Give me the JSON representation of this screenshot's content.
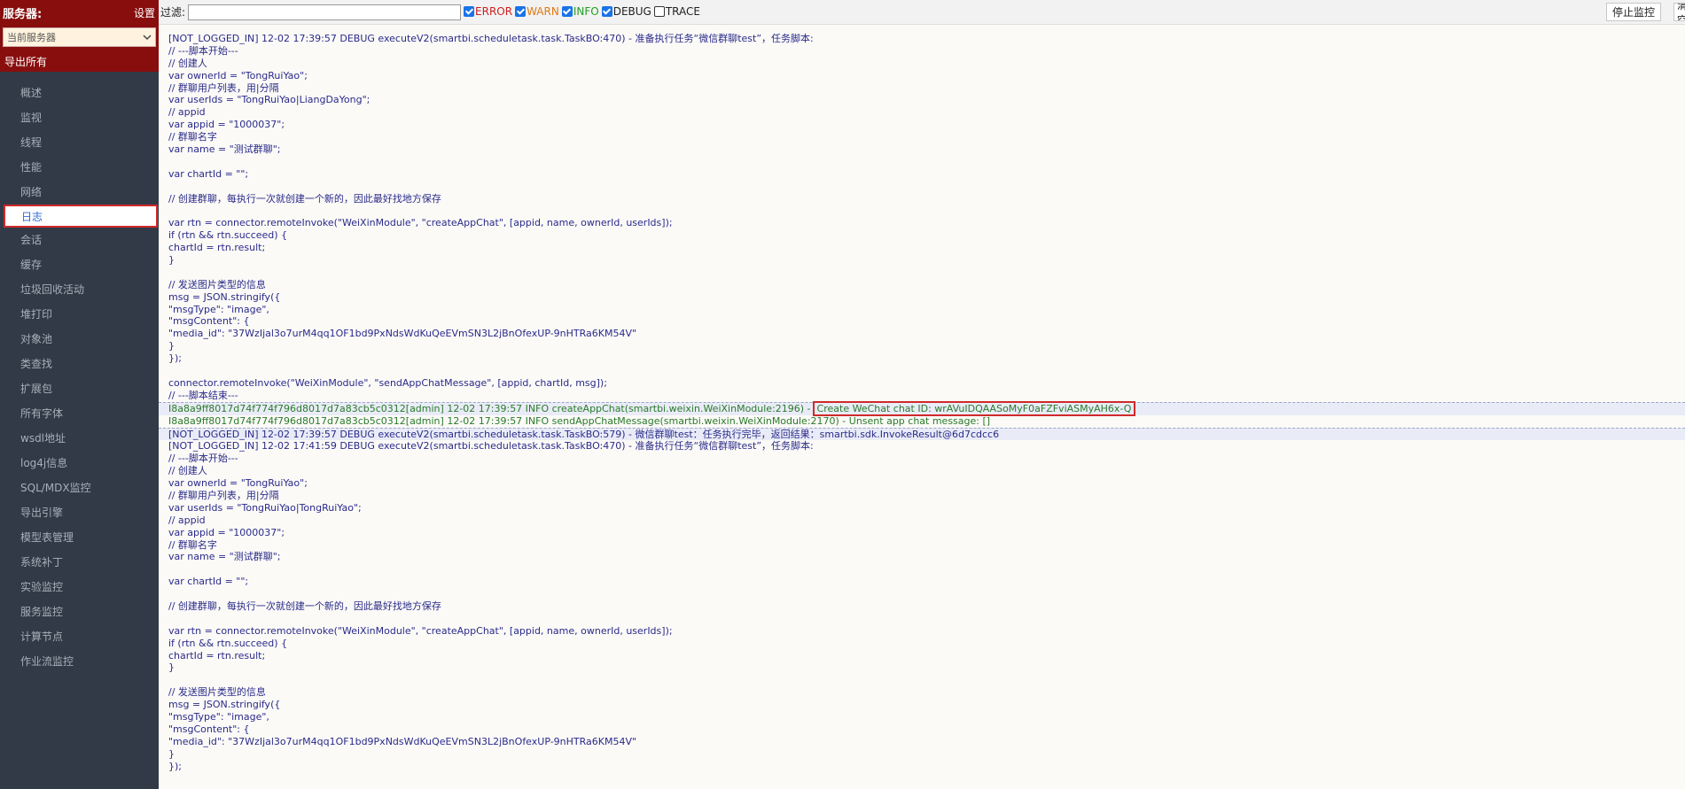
{
  "sidebar": {
    "server_title": "服务器:",
    "settings_label": "设置",
    "server_select_value": "当前服务器",
    "export_all_label": "导出所有",
    "nav_items": [
      {
        "label": "概述"
      },
      {
        "label": "监视"
      },
      {
        "label": "线程"
      },
      {
        "label": "性能"
      },
      {
        "label": "网络"
      },
      {
        "label": "日志",
        "active": true
      },
      {
        "label": "会话"
      },
      {
        "label": "缓存"
      },
      {
        "label": "垃圾回收活动"
      },
      {
        "label": "堆打印"
      },
      {
        "label": "对象池"
      },
      {
        "label": "类查找"
      },
      {
        "label": "扩展包"
      },
      {
        "label": "所有字体"
      },
      {
        "label": "wsdl地址"
      },
      {
        "label": "log4j信息"
      },
      {
        "label": "SQL/MDX监控"
      },
      {
        "label": "导出引擎"
      },
      {
        "label": "模型表管理"
      },
      {
        "label": "系统补丁"
      },
      {
        "label": "实验监控"
      },
      {
        "label": "服务监控"
      },
      {
        "label": "计算节点"
      },
      {
        "label": "作业流监控"
      }
    ]
  },
  "toolbar": {
    "filter_label": "过滤:",
    "filter_value": "",
    "levels": [
      {
        "label": "ERROR",
        "checked": true,
        "color": "#d02020"
      },
      {
        "label": "WARN",
        "checked": true,
        "color": "#e07a10"
      },
      {
        "label": "INFO",
        "checked": true,
        "color": "#20a020"
      },
      {
        "label": "DEBUG",
        "checked": true,
        "color": "#222222"
      },
      {
        "label": "TRACE",
        "checked": false,
        "color": "#222222"
      }
    ],
    "stop_label": "停止监控",
    "clear_label": "清空"
  },
  "log": {
    "lines": [
      {
        "text": "[NOT_LOGGED_IN] 12-02 17:39:57 DEBUG executeV2(smartbi.scheduletask.task.TaskBO:470) - 准备执行任务“微信群聊test”，任务脚本:",
        "level": "debug"
      },
      {
        "text": "// ---脚本开始---",
        "level": "debug"
      },
      {
        "text": "// 创建人",
        "level": "debug"
      },
      {
        "text": "var ownerId = \"TongRuiYao\";",
        "level": "debug"
      },
      {
        "text": "// 群聊用户列表，用|分隔",
        "level": "debug"
      },
      {
        "text": "var userIds = \"TongRuiYao|LiangDaYong\";",
        "level": "debug"
      },
      {
        "text": "// appid",
        "level": "debug"
      },
      {
        "text": "var appid = \"1000037\";",
        "level": "debug"
      },
      {
        "text": "// 群聊名字",
        "level": "debug"
      },
      {
        "text": "var name = \"测试群聊\";",
        "level": "debug"
      },
      {
        "text": "",
        "level": "debug"
      },
      {
        "text": "var chartId = \"\";",
        "level": "debug"
      },
      {
        "text": "",
        "level": "debug"
      },
      {
        "text": "// 创建群聊，每执行一次就创建一个新的，因此最好找地方保存",
        "level": "debug"
      },
      {
        "text": "",
        "level": "debug"
      },
      {
        "text": "var rtn = connector.remoteInvoke(\"WeiXinModule\", \"createAppChat\", [appid, name, ownerId, userIds]);",
        "level": "debug"
      },
      {
        "text": "if (rtn && rtn.succeed) {",
        "level": "debug"
      },
      {
        "text": "chartId = rtn.result;",
        "level": "debug"
      },
      {
        "text": "}",
        "level": "debug"
      },
      {
        "text": "",
        "level": "debug"
      },
      {
        "text": "// 发送图片类型的信息",
        "level": "debug"
      },
      {
        "text": "msg = JSON.stringify({",
        "level": "debug"
      },
      {
        "text": "\"msgType\": \"image\",",
        "level": "debug"
      },
      {
        "text": "\"msgContent\": {",
        "level": "debug"
      },
      {
        "text": "\"media_id\": \"37WzIjal3o7urM4qq1OF1bd9PxNdsWdKuQeEVmSN3L2jBnOfexUP-9nHTRa6KM54V\"",
        "level": "debug"
      },
      {
        "text": "}",
        "level": "debug"
      },
      {
        "text": "});",
        "level": "debug"
      },
      {
        "text": "",
        "level": "debug"
      },
      {
        "text": "connector.remoteInvoke(\"WeiXinModule\", \"sendAppChatMessage\", [appid, chartId, msg]);",
        "level": "debug"
      },
      {
        "text": "// ---脚本结束---",
        "level": "debug"
      },
      {
        "text": "I8a8a9ff8017d74f774f796d8017d7a83cb5c0312[admin] 12-02 17:39:57 INFO createAppChat(smartbi.weixin.WeiXinModule:2196) -",
        "level": "info",
        "highlight": "Create WeChat chat ID: wrAVuIDQAASoMyF0aFZFviASMyAH6x-Q",
        "band": true
      },
      {
        "text": "I8a8a9ff8017d74f774f796d8017d7a83cb5c0312[admin] 12-02 17:39:57 INFO sendAppChatMessage(smartbi.weixin.WeiXinModule:2170) - Unsent app chat message: []",
        "level": "info"
      },
      {
        "text": "[NOT_LOGGED_IN] 12-02 17:39:57 DEBUG executeV2(smartbi.scheduletask.task.TaskBO:579) - 微信群聊test：任务执行完毕，返回结果：smartbi.sdk.InvokeResult@6d7cdcc6",
        "level": "debug",
        "band": true
      },
      {
        "text": "[NOT_LOGGED_IN] 12-02 17:41:59 DEBUG executeV2(smartbi.scheduletask.task.TaskBO:470) - 准备执行任务“微信群聊test”，任务脚本:",
        "level": "debug"
      },
      {
        "text": "// ---脚本开始---",
        "level": "debug"
      },
      {
        "text": "// 创建人",
        "level": "debug"
      },
      {
        "text": "var ownerId = \"TongRuiYao\";",
        "level": "debug"
      },
      {
        "text": "// 群聊用户列表，用|分隔",
        "level": "debug"
      },
      {
        "text": "var userIds = \"TongRuiYao|TongRuiYao\";",
        "level": "debug"
      },
      {
        "text": "// appid",
        "level": "debug"
      },
      {
        "text": "var appid = \"1000037\";",
        "level": "debug"
      },
      {
        "text": "// 群聊名字",
        "level": "debug"
      },
      {
        "text": "var name = \"测试群聊\";",
        "level": "debug"
      },
      {
        "text": "",
        "level": "debug"
      },
      {
        "text": "var chartId = \"\";",
        "level": "debug"
      },
      {
        "text": "",
        "level": "debug"
      },
      {
        "text": "// 创建群聊，每执行一次就创建一个新的，因此最好找地方保存",
        "level": "debug"
      },
      {
        "text": "",
        "level": "debug"
      },
      {
        "text": "var rtn = connector.remoteInvoke(\"WeiXinModule\", \"createAppChat\", [appid, name, ownerId, userIds]);",
        "level": "debug"
      },
      {
        "text": "if (rtn && rtn.succeed) {",
        "level": "debug"
      },
      {
        "text": "chartId = rtn.result;",
        "level": "debug"
      },
      {
        "text": "}",
        "level": "debug"
      },
      {
        "text": "",
        "level": "debug"
      },
      {
        "text": "// 发送图片类型的信息",
        "level": "debug"
      },
      {
        "text": "msg = JSON.stringify({",
        "level": "debug"
      },
      {
        "text": "\"msgType\": \"image\",",
        "level": "debug"
      },
      {
        "text": "\"msgContent\": {",
        "level": "debug"
      },
      {
        "text": "\"media_id\": \"37WzIjal3o7urM4qq1OF1bd9PxNdsWdKuQeEVmSN3L2jBnOfexUP-9nHTRa6KM54V\"",
        "level": "debug"
      },
      {
        "text": "}",
        "level": "debug"
      },
      {
        "text": "});",
        "level": "debug"
      }
    ]
  }
}
